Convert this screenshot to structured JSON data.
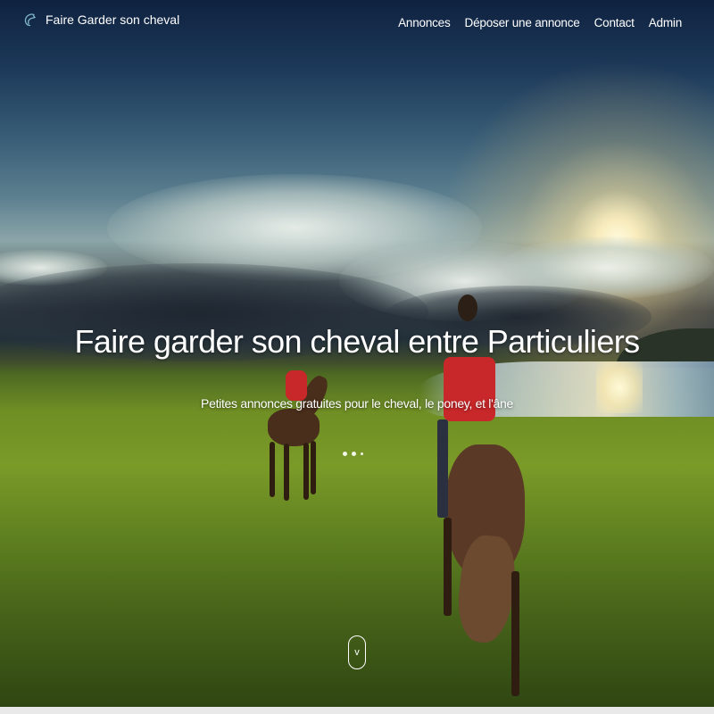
{
  "navbar": {
    "brand": "Faire Garder son cheval",
    "links": [
      "Annonces",
      "Déposer une annonce",
      "Contact",
      "Admin"
    ]
  },
  "hero": {
    "title": "Faire garder son cheval entre Particuliers",
    "subtitle": "Petites annonces gratuites pour le cheval, le poney, et l'âne",
    "carousel_dots": 3,
    "scroll_icon": "chevron-down-icon"
  },
  "colors": {
    "text": "#ffffff",
    "logo": "#7fb8c8"
  }
}
